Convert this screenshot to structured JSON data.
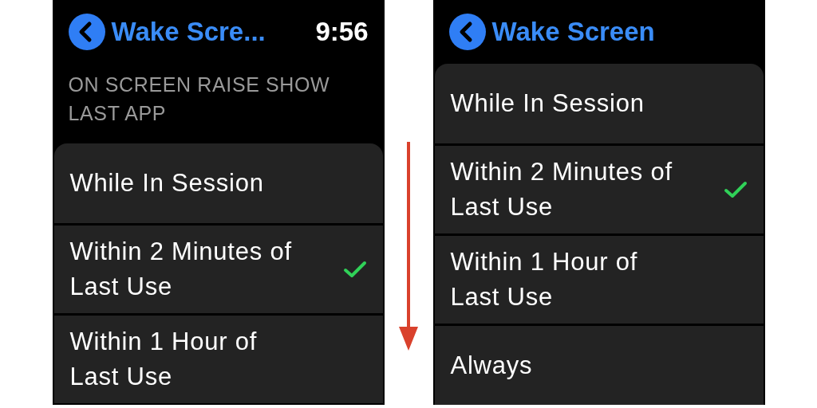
{
  "screens": [
    {
      "title": "Wake Scre...",
      "time": "9:56",
      "section_header": "ON SCREEN RAISE SHOW LAST APP",
      "options": [
        {
          "label": "While In Session",
          "selected": false
        },
        {
          "label": "Within 2 Minutes of Last Use",
          "selected": true
        },
        {
          "label": "Within 1 Hour of Last Use",
          "selected": false
        }
      ]
    },
    {
      "title": "Wake Screen",
      "options": [
        {
          "label": "While In Session",
          "selected": false
        },
        {
          "label": "Within 2 Minutes of Last Use",
          "selected": true
        },
        {
          "label": "Within 1 Hour of Last Use",
          "selected": false
        },
        {
          "label": "Always",
          "selected": false
        }
      ]
    }
  ]
}
